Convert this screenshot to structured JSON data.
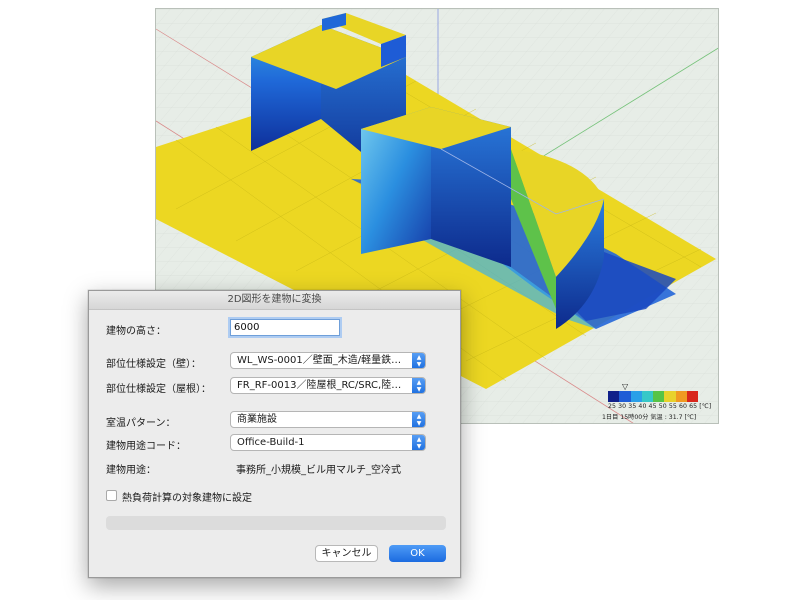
{
  "legend": {
    "colors": [
      "#10208a",
      "#1e5cd6",
      "#2aa0e8",
      "#37c8c8",
      "#57c447",
      "#e8d22c",
      "#f09a22",
      "#d8261c"
    ],
    "ticks": "25 30 35 40 45 50 55 60 65 [℃]",
    "status": "1日目 15時00分  気温 : 31.7 [℃]",
    "pointer": "▽"
  },
  "dialog": {
    "title": "2D図形を建物に変換",
    "height_label": "建物の高さ：",
    "height_value": "6000",
    "wall_label": "部位仕様設定（壁）：",
    "wall_value": "WL_WS-0001／壁面_木造/軽量鉄…",
    "roof_label": "部位仕様設定（屋根）：",
    "roof_value": "FR_RF-0013／陸屋根_RC/SRC,陸…",
    "room_temp_label": "室温パターン：",
    "room_temp_value": "商業施設",
    "use_code_label": "建物用途コード：",
    "use_code_value": "Office-Build-1",
    "use_label": "建物用途：",
    "use_value": "事務所_小規模_ビル用マルチ_空冷式",
    "heat_load_label": "熱負荷計算の対象建物に設定",
    "heat_load_checked": false,
    "cancel_label": "キャンセル",
    "ok_label": "OK"
  }
}
